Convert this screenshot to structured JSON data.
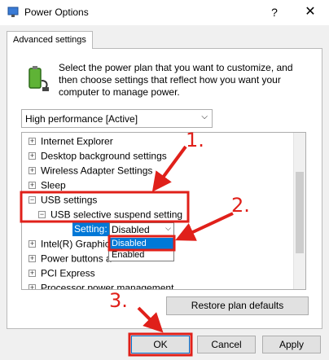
{
  "window": {
    "title": "Power Options",
    "help_glyph": "?",
    "close_glyph": "✕"
  },
  "tab": {
    "label": "Advanced settings"
  },
  "description": "Select the power plan that you want to customize, and then choose settings that reflect how you want your computer to manage power.",
  "plan_select": {
    "value": "High performance [Active]",
    "arrow": "⌵"
  },
  "tree": {
    "items": [
      {
        "label": "Internet Explorer",
        "toggle": "+"
      },
      {
        "label": "Desktop background settings",
        "toggle": "+"
      },
      {
        "label": "Wireless Adapter Settings",
        "toggle": "+"
      },
      {
        "label": "Sleep",
        "toggle": "+"
      },
      {
        "label": "USB settings",
        "toggle": "−"
      },
      {
        "label": "USB selective suspend setting",
        "toggle": "−"
      },
      {
        "label": "Intel(R) Graphic",
        "toggle": "+"
      },
      {
        "label": "Power buttons a",
        "toggle": "+"
      },
      {
        "label": "PCI Express",
        "toggle": "+"
      },
      {
        "label": "Processor power management",
        "toggle": "+"
      }
    ],
    "setting_label": "Setting:",
    "setting_value": "Disabled",
    "setting_arrow": "⌵",
    "dropdown_options": [
      "Disabled",
      "Enabled"
    ]
  },
  "buttons": {
    "restore": "Restore plan defaults",
    "ok": "OK",
    "cancel": "Cancel",
    "apply": "Apply"
  },
  "annotations": {
    "step1": "1.",
    "step2": "2.",
    "step3": "3.",
    "color": "#e0201a"
  }
}
